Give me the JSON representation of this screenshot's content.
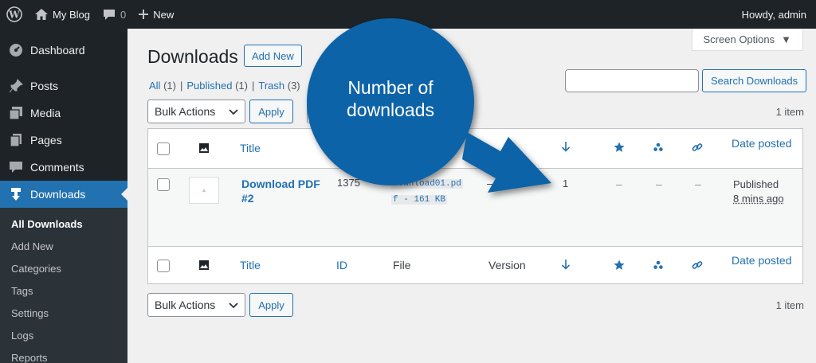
{
  "adminbar": {
    "site_name": "My Blog",
    "comments_count": "0",
    "new_label": "New",
    "howdy": "Howdy, admin"
  },
  "sidebar": {
    "items": [
      {
        "label": "Dashboard",
        "icon": "dashboard-icon"
      },
      {
        "label": "Posts",
        "icon": "pin-icon"
      },
      {
        "label": "Media",
        "icon": "media-icon"
      },
      {
        "label": "Pages",
        "icon": "pages-icon"
      },
      {
        "label": "Comments",
        "icon": "comment-icon"
      },
      {
        "label": "Downloads",
        "icon": "download-icon"
      }
    ],
    "submenu": [
      "All Downloads",
      "Add New",
      "Categories",
      "Tags",
      "Settings",
      "Logs",
      "Reports"
    ]
  },
  "screen_options": "Screen Options",
  "page": {
    "title": "Downloads",
    "add_new": "Add New"
  },
  "filters": {
    "all": "All",
    "all_count": "(1)",
    "published": "Published",
    "published_count": "(1)",
    "trash": "Trash",
    "trash_count": "(3)"
  },
  "search": {
    "button": "Search Downloads",
    "placeholder": ""
  },
  "bulk": {
    "label": "Bulk Actions",
    "apply": "Apply"
  },
  "items_count": "1 item",
  "table": {
    "headers": {
      "title": "Title",
      "id": "ID",
      "file": "File",
      "version": "Version",
      "date": "Date posted"
    },
    "row": {
      "title_line1": "Download PDF",
      "title_line2": "#2",
      "id": "1375",
      "file_line1": "download01.pd",
      "file_line2": "f - 161 KB",
      "version": "–",
      "downloads": "1",
      "featured": "–",
      "members": "–",
      "redirect": "–",
      "status": "Published",
      "ago": "8 mins ago"
    }
  },
  "annotation": {
    "text_line1": "Number of",
    "text_line2": "downloads",
    "color": "#0a63a8"
  },
  "colors": {
    "accent": "#2271b1",
    "adminbar": "#1d2327"
  }
}
